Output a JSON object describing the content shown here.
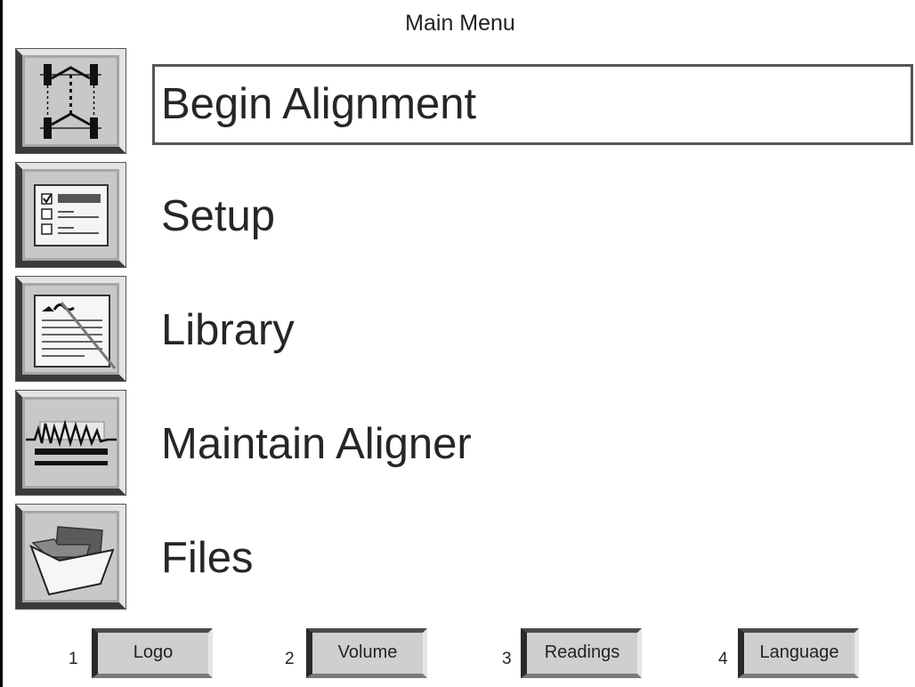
{
  "window": {
    "title": "Main Menu"
  },
  "menu": {
    "items": [
      {
        "label": "Begin Alignment",
        "icon": "vehicle-alignment-icon",
        "selected": true
      },
      {
        "label": "Setup",
        "icon": "checklist-icon",
        "selected": false
      },
      {
        "label": "Library",
        "icon": "document-library-icon",
        "selected": false
      },
      {
        "label": "Maintain Aligner",
        "icon": "signal-waveform-icon",
        "selected": false
      },
      {
        "label": "Files",
        "icon": "open-folder-icon",
        "selected": false
      }
    ]
  },
  "function_keys": [
    {
      "number": "1",
      "label": "Logo"
    },
    {
      "number": "2",
      "label": "Volume"
    },
    {
      "number": "3",
      "label": "Readings"
    },
    {
      "number": "4",
      "label": "Language"
    }
  ]
}
